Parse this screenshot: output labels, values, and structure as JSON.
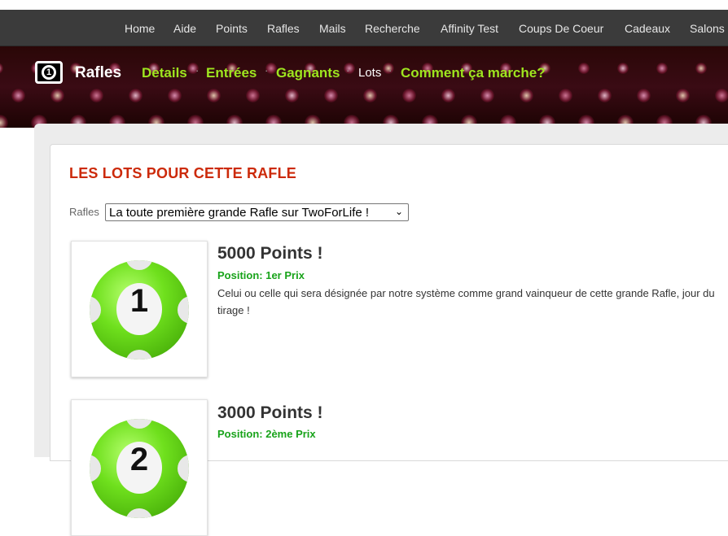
{
  "top_nav": [
    "Home",
    "Aide",
    "Points",
    "Rafles",
    "Mails",
    "Recherche",
    "Affinity Test",
    "Coups De Coeur",
    "Cadeaux",
    "Salons"
  ],
  "app": {
    "title": "Rafles"
  },
  "sub_nav": [
    {
      "label": "Details",
      "current": false
    },
    {
      "label": "Entrées",
      "current": false
    },
    {
      "label": "Gagnants",
      "current": false
    },
    {
      "label": "Lots",
      "current": true
    },
    {
      "label": "Comment ça marche?",
      "current": false
    }
  ],
  "section": {
    "title": "LES LOTS POUR CETTE RAFLE"
  },
  "rafle_select": {
    "label": "Rafles",
    "value": "La toute première grande Rafle sur TwoForLife !"
  },
  "prizes": [
    {
      "ball_number": "1",
      "title": "5000 Points !",
      "position": "Position: 1er Prix",
      "description": "Celui ou celle qui sera désignée par notre système comme grand vainqueur de cette  grande Rafle, jour du tirage !"
    },
    {
      "ball_number": "2",
      "title": "3000 Points !",
      "position": "Position: 2ème Prix",
      "description": ""
    }
  ],
  "colors": {
    "accent_green": "#9ee51f",
    "title_red": "#cc2a0a",
    "position_green": "#18a31a",
    "nav_bg": "#3b3b3b"
  }
}
